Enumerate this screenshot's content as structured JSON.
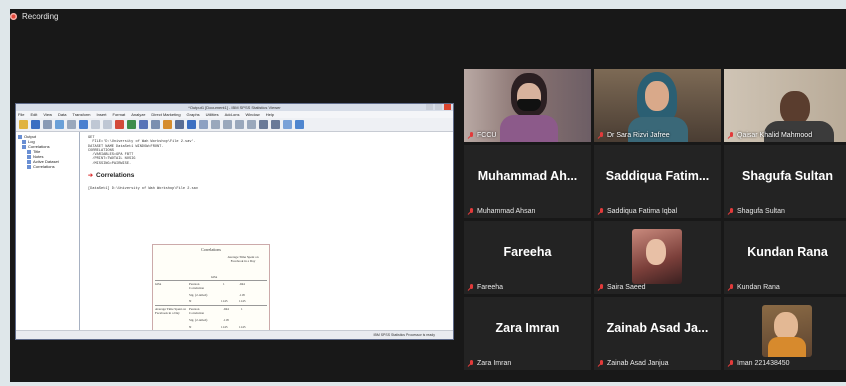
{
  "recording": {
    "label": "Recording"
  },
  "spss": {
    "window_title": "*Output1 [Document1] - IBM SPSS Statistics Viewer",
    "menu": [
      "File",
      "Edit",
      "View",
      "Data",
      "Transform",
      "Insert",
      "Format",
      "Analyze",
      "Direct Marketing",
      "Graphs",
      "Utilities",
      "Add-ons",
      "Window",
      "Help"
    ],
    "tree": [
      "Output",
      "Log",
      "Correlations",
      "Title",
      "Notes",
      "Active Dataset",
      "Correlations"
    ],
    "syntax": [
      "GET",
      "  FILE='D:\\University of Wah Workshop\\File 2.sav'.",
      "DATASET NAME DataSet1 WINDOW=FRONT.",
      "CORRELATIONS",
      "  /VARIABLES=GPA FBTT",
      "  /PRINT=TWOTAIL NOSIG",
      "  /MISSING=PAIRWISE."
    ],
    "section": "Correlations",
    "dataset": "[DataSet1] D:\\University of Wah Workshop\\File 2.sav",
    "table": {
      "title": "Correlations",
      "col_head": "Average Time Spent on Facebook in a Day",
      "gpa": "GPA",
      "row1_label": "GPA",
      "pearson": "Pearson Correlation",
      "sig": "Sig. (2-tailed)",
      "n": "N",
      "row2_label": "Average Time Spent on Facebook in a Day",
      "v_1": "1",
      "v_r": ".044",
      "v_sig": ".118",
      "v_n1": "1145",
      "v_n2": "1145"
    },
    "status": "IBM SPSS Statistics Processor is ready"
  },
  "participants": [
    {
      "id": "fccu",
      "label": "FCCU",
      "type": "video"
    },
    {
      "id": "sara",
      "label": "Dr Sara Rizvi Jafree",
      "type": "video"
    },
    {
      "id": "qaisar",
      "label": "Qaisar Khalid Mahmood",
      "type": "video",
      "active": true
    },
    {
      "id": "ahsan",
      "name": "Muhammad Ah...",
      "label": "Muhammad Ahsan",
      "type": "name"
    },
    {
      "id": "saddiqua",
      "name": "Saddiqua Fatim...",
      "label": "Saddiqua Fatima Iqbal",
      "type": "name"
    },
    {
      "id": "shagufa",
      "name": "Shagufa Sultan",
      "label": "Shagufa Sultan",
      "type": "name"
    },
    {
      "id": "fareeha",
      "name": "Fareeha",
      "label": "Fareeha",
      "type": "name"
    },
    {
      "id": "saira",
      "label": "Saira Saeed",
      "type": "photo"
    },
    {
      "id": "kundan",
      "name": "Kundan Rana",
      "label": "Kundan Rana",
      "type": "name"
    },
    {
      "id": "zara",
      "name": "Zara Imran",
      "label": "Zara Imran",
      "type": "name"
    },
    {
      "id": "zainab",
      "name": "Zainab Asad Ja...",
      "label": "Zainab Asad Janjua",
      "type": "name"
    },
    {
      "id": "iman",
      "label": "Iman 221438450",
      "type": "photo"
    }
  ]
}
